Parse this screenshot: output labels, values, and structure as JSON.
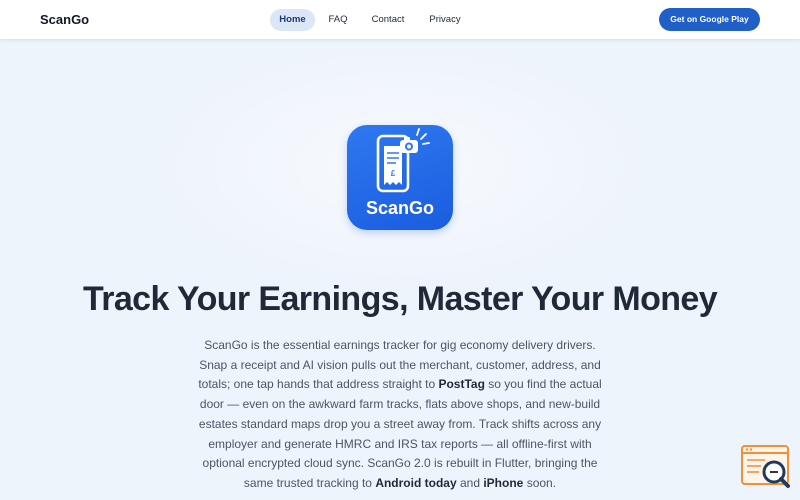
{
  "nav": {
    "brand": "ScanGo",
    "links": [
      {
        "label": "Home",
        "active": true
      },
      {
        "label": "FAQ",
        "active": false
      },
      {
        "label": "Contact",
        "active": false
      },
      {
        "label": "Privacy",
        "active": false
      }
    ],
    "cta_label": "Get on Google Play"
  },
  "hero": {
    "app_icon": {
      "icon": "receipt-camera-icon",
      "name": "ScanGo",
      "receipt_symbol": "£"
    },
    "headline": "Track Your Earnings, Master Your Money",
    "description": {
      "t1": "ScanGo is the essential earnings tracker for gig economy delivery drivers. Snap a receipt and AI vision pulls out the merchant, customer, address, and totals; one tap hands that address straight to ",
      "b1": "PostTag",
      "t2": " so you find the actual door — even on the awkward farm tracks, flats above shops, and new-build estates standard maps drop you a street away from. Track shifts across any employer and generate HMRC and IRS tax reports — all offline-first with optional encrypted cloud sync. ScanGo 2.0 is rebuilt in Flutter, bringing the same trusted tracking to ",
      "b2": "Android today",
      "t3": " and ",
      "b3": "iPhone",
      "t4": " soon."
    }
  },
  "widget": {
    "icon": "support-search-icon"
  },
  "colors": {
    "accent": "#1f5fc7",
    "background": "#eef4fc",
    "nav_active_bg": "#dbe6f7",
    "icon_gradient_top": "#2f78f0",
    "widget_orange": "#f0913a",
    "widget_navy": "#1f3a5c"
  }
}
